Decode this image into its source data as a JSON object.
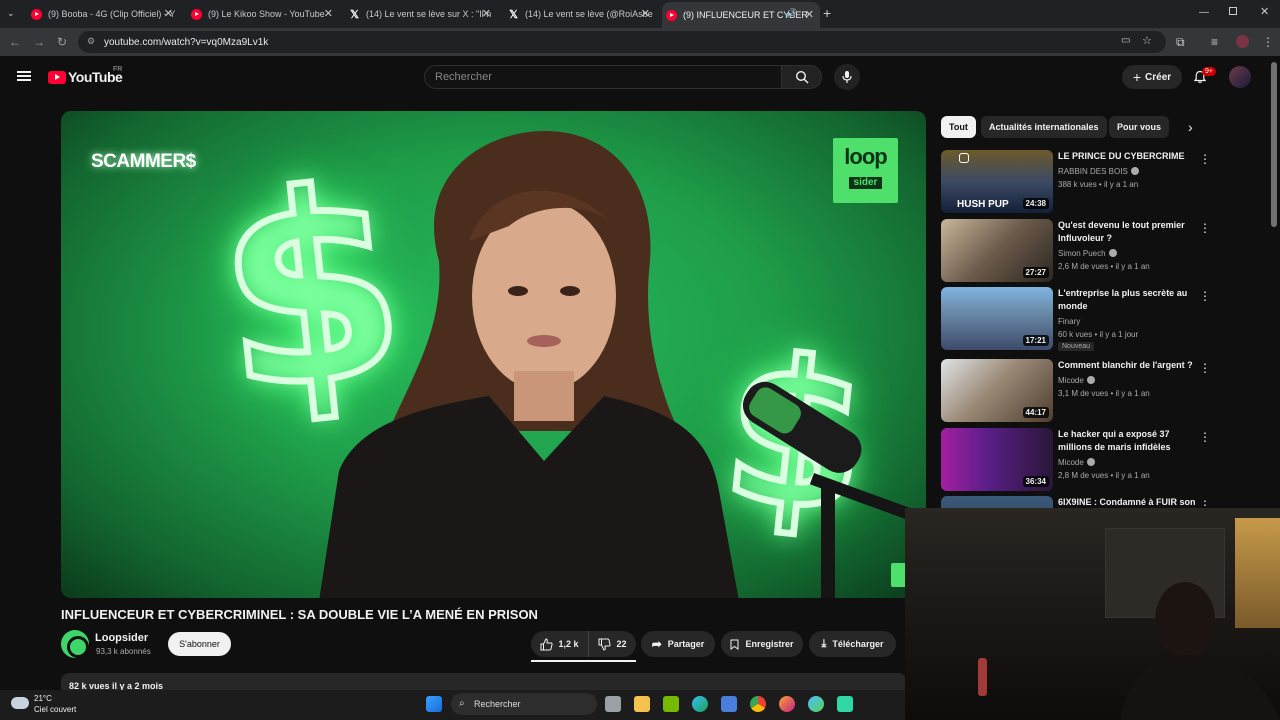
{
  "browser": {
    "tabs": [
      {
        "title": "(9) Booba - 4G (Clip Officiel) - Y",
        "icon": "youtube-icon"
      },
      {
        "title": "(9) Le Kikoo Show - YouTube",
        "icon": "youtube-icon"
      },
      {
        "title": "(14) Le vent se lève sur X : \"Il n",
        "icon": "x-icon"
      },
      {
        "title": "(14) Le vent se lève (@RoiAsbe",
        "icon": "x-icon"
      },
      {
        "title": "(9) INFLUENCEUR ET CYBER",
        "icon": "youtube-icon",
        "active": true
      }
    ],
    "url": "youtube.com/watch?v=vq0Mza9Lv1k"
  },
  "header": {
    "logo_text": "YouTube",
    "country_code": "FR",
    "search_placeholder": "Rechercher",
    "create_label": "Créer",
    "notification_count": "9+"
  },
  "player": {
    "badge_left": "SCAMMER$",
    "badge_right_top": "loop",
    "badge_right_bottom": "sider"
  },
  "video": {
    "title": "INFLUENCEUR ET CYBERCRIMINEL : SA DOUBLE VIE L’A MENÉ EN PRISON",
    "channel": "Loopsider",
    "subscribers": "93,3 k abonnés",
    "subscribe_label": "S'abonner",
    "likes": "1,2 k",
    "dislikes": "22",
    "share_label": "Partager",
    "save_label": "Enregistrer",
    "download_label": "Télécharger",
    "description_preview": "82 k vues  il y a 2 mois"
  },
  "sidebar": {
    "chips": [
      "Tout",
      "Actualités internationales",
      "Pour vous"
    ],
    "recommendations": [
      {
        "title": "LE PRINCE DU CYBERCRIME",
        "channel": "RABBIN DES BOIS",
        "meta": "388 k vues • il y a 1 an",
        "duration": "24:38",
        "thumb_text": "HUSH PUP"
      },
      {
        "title": "Qu'est devenu le tout premier Influvoleur ?",
        "channel": "Simon Puech",
        "meta": "2,6 M de vues • il y a 1 an",
        "duration": "27:27"
      },
      {
        "title": "L'entreprise la plus secrète au monde",
        "channel": "Finary",
        "meta": "60 k vues • il y a 1 jour",
        "duration": "17:21",
        "badge": "Nouveau"
      },
      {
        "title": "Comment blanchir de l'argent ?",
        "channel": "Micode",
        "meta": "3,1 M de vues • il y a 1 an",
        "duration": "44:17"
      },
      {
        "title": "Le hacker qui a exposé 37 millions de maris infidèles",
        "channel": "Micode",
        "meta": "2,8 M de vues • il y a 1 an",
        "duration": "36:34"
      },
      {
        "title": "6IX9INE : Condamné à FUIR son"
      }
    ]
  },
  "taskbar": {
    "temperature": "21°C",
    "weather": "Ciel couvert",
    "search_label": "Rechercher"
  },
  "colors": {
    "accent": "#ff0033",
    "background": "#0f0f0f",
    "surface": "#272727",
    "loop_green": "#4ee06b"
  }
}
